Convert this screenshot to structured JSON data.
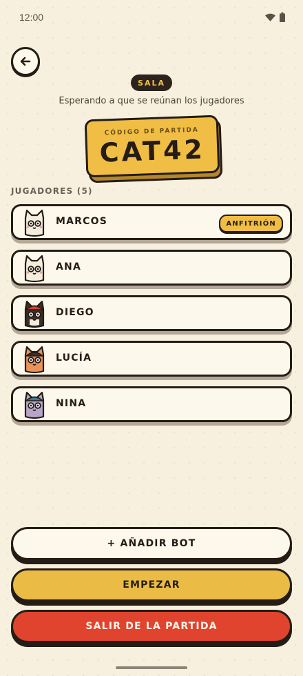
{
  "status_bar": {
    "time": "12:00",
    "icons": [
      "wifi-icon",
      "battery-icon"
    ]
  },
  "header": {
    "back_icon": "arrow-left-icon",
    "badge": "SALA",
    "subtitle": "Esperando a que se reúnan los jugadores"
  },
  "code_card": {
    "label": "CÓDIGO DE PARTIDA",
    "code": "CAT42"
  },
  "players": {
    "heading": "JUGADORES (5)",
    "items": [
      {
        "name": "MARCOS",
        "badge": "ANFITRIÓN",
        "avatar": "cat-avatar-white"
      },
      {
        "name": "ANA",
        "avatar": "cat-avatar-white"
      },
      {
        "name": "DIEGO",
        "avatar": "cat-avatar-dark-red-cap"
      },
      {
        "name": "LUCÍA",
        "avatar": "cat-avatar-orange"
      },
      {
        "name": "NINA",
        "avatar": "cat-avatar-purple-blue-cap"
      }
    ]
  },
  "actions": {
    "add_bot": "+ AÑADIR BOT",
    "start": "EMPEZAR",
    "leave": "SALIR DE LA PARTIDA"
  },
  "colors": {
    "background": "#f8f0de",
    "accent_yellow": "#f0bd45",
    "danger_red": "#e0442e",
    "outline": "#241c15"
  }
}
